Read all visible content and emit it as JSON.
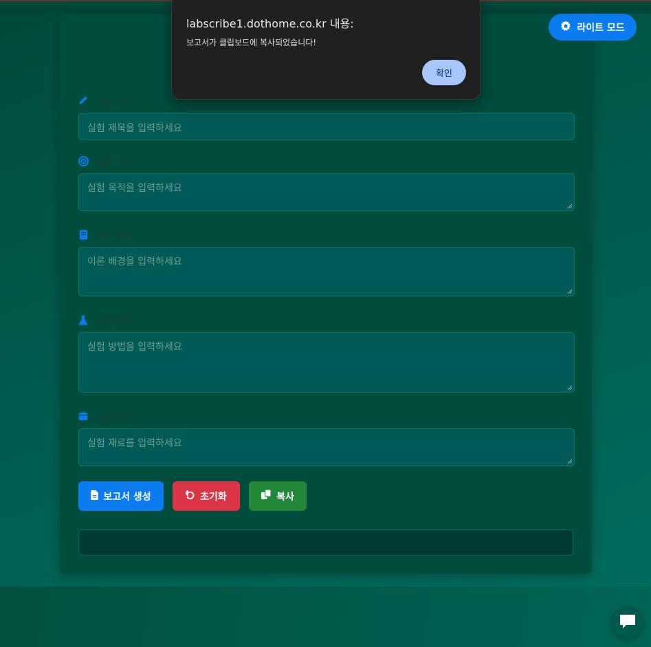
{
  "dialog": {
    "title": "labscribe1.dothome.co.kr 내용:",
    "message": "보고서가 클립보드에 복사되었습니다!",
    "ok_label": "확인"
  },
  "mode_toggle": {
    "label": "라이트 모드",
    "icon": "gear-icon"
  },
  "fields": [
    {
      "label": "실험 제목",
      "placeholder": "실험 제목을 입력하세요",
      "icon": "pen-icon"
    },
    {
      "label": "실험 목적",
      "placeholder": "실험 목적을 입력하세요",
      "icon": "target-icon"
    },
    {
      "label": "이론 배경",
      "placeholder": "이론 배경을 입력하세요",
      "icon": "book-icon"
    },
    {
      "label": "실험 방법",
      "placeholder": "실험 방법을 입력하세요",
      "icon": "flask-icon"
    },
    {
      "label": "실험 재료",
      "placeholder": "실험 재료를 입력하세요",
      "icon": "box-icon"
    }
  ],
  "buttons": {
    "generate": "보고서 생성",
    "reset": "초기화",
    "copy": "복사"
  },
  "colors": {
    "primary": "#0a7cf0",
    "danger": "#dc3545",
    "success": "#218838"
  }
}
